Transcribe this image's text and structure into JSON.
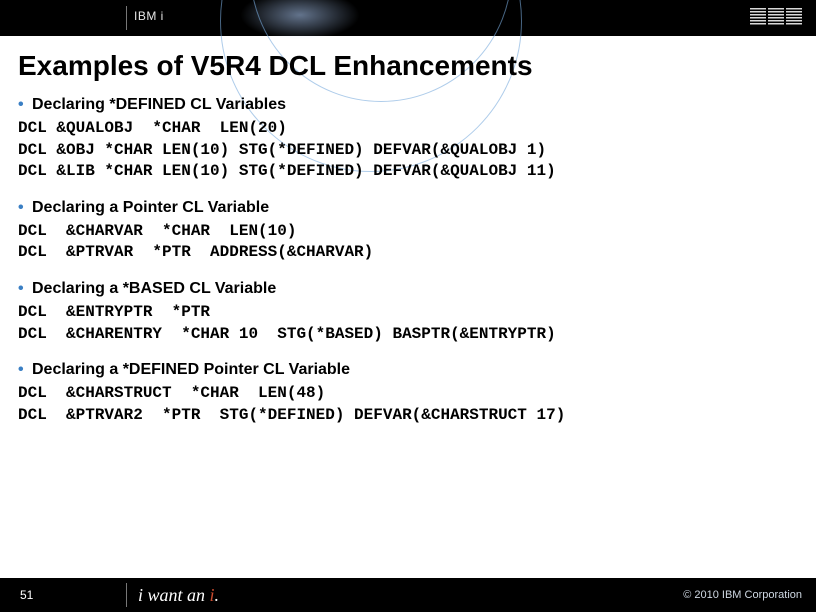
{
  "header": {
    "product": "IBM i",
    "logo_text": "IBM"
  },
  "title": "Examples of V5R4 DCL Enhancements",
  "sections": [
    {
      "heading": "Declaring *DEFINED CL Variables",
      "lines": [
        "DCL &QUALOBJ  *CHAR  LEN(20)",
        "DCL &OBJ *CHAR LEN(10) STG(*DEFINED) DEFVAR(&QUALOBJ 1)",
        "DCL &LIB *CHAR LEN(10) STG(*DEFINED) DEFVAR(&QUALOBJ 11)"
      ]
    },
    {
      "heading": "Declaring a Pointer CL Variable",
      "lines": [
        "DCL  &CHARVAR  *CHAR  LEN(10)",
        "DCL  &PTRVAR  *PTR  ADDRESS(&CHARVAR)"
      ]
    },
    {
      "heading": "Declaring a *BASED CL Variable",
      "lines": [
        "DCL  &ENTRYPTR  *PTR",
        "DCL  &CHARENTRY  *CHAR 10  STG(*BASED) BASPTR(&ENTRYPTR)"
      ]
    },
    {
      "heading": "Declaring a *DEFINED Pointer CL Variable",
      "lines": [
        "DCL  &CHARSTRUCT  *CHAR  LEN(48)",
        "DCL  &PTRVAR2  *PTR  STG(*DEFINED) DEFVAR(&CHARSTRUCT 17)"
      ]
    }
  ],
  "footer": {
    "slide_number": "51",
    "tagline_prefix": "i want an ",
    "tagline_accent": "i",
    "tagline_suffix": ".",
    "copyright": "© 2010 IBM Corporation"
  }
}
